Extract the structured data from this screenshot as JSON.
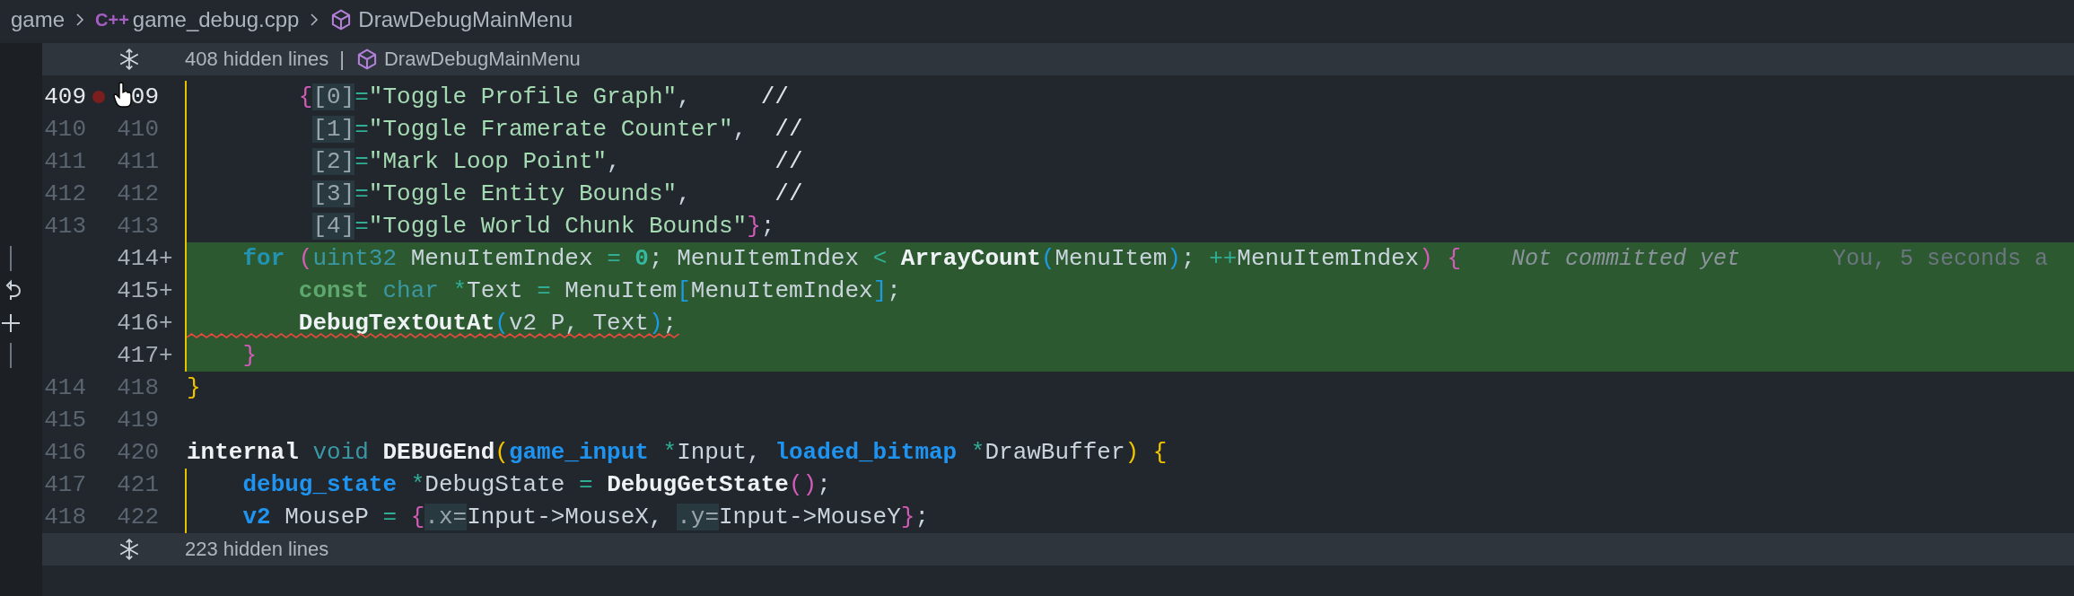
{
  "breadcrumb": [
    {
      "kind": "folder",
      "text": "game"
    },
    {
      "kind": "file",
      "badge": "C++",
      "text": "game_debug.cpp"
    },
    {
      "kind": "symbol",
      "text": "DrawDebugMainMenu"
    }
  ],
  "folds_top": {
    "text": "408 hidden lines",
    "separator": "|",
    "symbol": "DrawDebugMainMenu"
  },
  "lines": [
    {
      "old": "409",
      "new": "09",
      "added": false,
      "breakpoint": true,
      "current": true,
      "error": false,
      "guide": true,
      "tokens": [
        {
          "kind": "pink",
          "text": "        {"
        },
        {
          "kind": "hint",
          "text": "[0]"
        },
        {
          "kind": "op",
          "text": "="
        },
        {
          "kind": "string",
          "text": "\"Toggle Profile Graph\""
        },
        {
          "kind": "plain",
          "text": ",     "
        },
        {
          "kind": "comment",
          "text": "//"
        }
      ]
    },
    {
      "old": "410",
      "new": "410",
      "added": false,
      "breakpoint": false,
      "current": false,
      "error": false,
      "guide": true,
      "tokens": [
        {
          "kind": "hint",
          "text": "         [1]"
        },
        {
          "kind": "op",
          "text": "="
        },
        {
          "kind": "string",
          "text": "\"Toggle Framerate Counter\""
        },
        {
          "kind": "plain",
          "text": ",  "
        },
        {
          "kind": "comment",
          "text": "//"
        }
      ]
    },
    {
      "old": "411",
      "new": "411",
      "added": false,
      "breakpoint": false,
      "current": false,
      "error": false,
      "guide": true,
      "tokens": [
        {
          "kind": "hint",
          "text": "         [2]"
        },
        {
          "kind": "op",
          "text": "="
        },
        {
          "kind": "string",
          "text": "\"Mark Loop Point\""
        },
        {
          "kind": "plain",
          "text": ",           "
        },
        {
          "kind": "comment",
          "text": "//"
        }
      ]
    },
    {
      "old": "412",
      "new": "412",
      "added": false,
      "breakpoint": false,
      "current": false,
      "error": false,
      "guide": true,
      "tokens": [
        {
          "kind": "hint",
          "text": "         [3]"
        },
        {
          "kind": "op",
          "text": "="
        },
        {
          "kind": "string",
          "text": "\"Toggle Entity Bounds\""
        },
        {
          "kind": "plain",
          "text": ",      "
        },
        {
          "kind": "comment",
          "text": "//"
        }
      ]
    },
    {
      "old": "413",
      "new": "413",
      "added": false,
      "breakpoint": false,
      "current": false,
      "error": false,
      "guide": true,
      "tokens": [
        {
          "kind": "hint",
          "text": "         [4]"
        },
        {
          "kind": "op",
          "text": "="
        },
        {
          "kind": "string",
          "text": "\"Toggle World Chunk Bounds\""
        },
        {
          "kind": "pink",
          "text": "}"
        },
        {
          "kind": "plain",
          "text": ";"
        }
      ]
    },
    {
      "new": "414",
      "marker": "+",
      "added": true,
      "breakpoint": false,
      "current": false,
      "error": false,
      "guide": true,
      "tokens": [
        {
          "kind": "keyword",
          "text": "    for "
        },
        {
          "kind": "pink",
          "text": "("
        },
        {
          "kind": "type2",
          "text": "uint32"
        },
        {
          "kind": "plain",
          "text": " MenuItemIndex "
        },
        {
          "kind": "op",
          "text": "= "
        },
        {
          "kind": "number",
          "text": "0"
        },
        {
          "kind": "plain",
          "text": "; MenuItemIndex "
        },
        {
          "kind": "op",
          "text": "< "
        },
        {
          "kind": "func",
          "text": "ArrayCount"
        },
        {
          "kind": "blue",
          "text": "("
        },
        {
          "kind": "plain",
          "text": "MenuItem"
        },
        {
          "kind": "blue",
          "text": ")"
        },
        {
          "kind": "plain",
          "text": "; "
        },
        {
          "kind": "op",
          "text": "++"
        },
        {
          "kind": "plain",
          "text": "MenuItemIndex"
        },
        {
          "kind": "pink",
          "text": ") {"
        }
      ],
      "blame": [
        "Not committed yet",
        "You, 5 seconds a"
      ]
    },
    {
      "new": "415",
      "marker": "+",
      "added": true,
      "breakpoint": false,
      "current": false,
      "error": false,
      "guide": true,
      "tokens": [
        {
          "kind": "keyword2",
          "text": "        const "
        },
        {
          "kind": "type2",
          "text": "char "
        },
        {
          "kind": "op",
          "text": "*"
        },
        {
          "kind": "plain",
          "text": "Text "
        },
        {
          "kind": "op",
          "text": "="
        },
        {
          "kind": "plain",
          "text": " MenuItem"
        },
        {
          "kind": "blue",
          "text": "["
        },
        {
          "kind": "plain",
          "text": "MenuItemIndex"
        },
        {
          "kind": "blue",
          "text": "]"
        },
        {
          "kind": "plain",
          "text": ";"
        }
      ]
    },
    {
      "new": "416",
      "marker": "+",
      "added": true,
      "breakpoint": false,
      "current": false,
      "error": true,
      "guide": true,
      "tokens": [
        {
          "kind": "func",
          "text": "        DebugTextOutAt"
        },
        {
          "kind": "blue",
          "text": "("
        },
        {
          "kind": "plain",
          "text": "v2 P, Text"
        },
        {
          "kind": "blue",
          "text": ")"
        },
        {
          "kind": "plain",
          "text": ";"
        }
      ]
    },
    {
      "new": "417",
      "marker": "+",
      "added": true,
      "breakpoint": false,
      "current": false,
      "error": false,
      "guide": true,
      "tokens": [
        {
          "kind": "pink",
          "text": "    }"
        }
      ]
    },
    {
      "old": "414",
      "new": "418",
      "added": false,
      "breakpoint": false,
      "current": false,
      "error": false,
      "guide": false,
      "tokens": [
        {
          "kind": "yellow",
          "text": "}"
        }
      ]
    },
    {
      "old": "415",
      "new": "419",
      "added": false,
      "breakpoint": false,
      "current": false,
      "error": false,
      "guide": false
    },
    {
      "old": "416",
      "new": "420",
      "added": false,
      "breakpoint": false,
      "current": false,
      "error": false,
      "guide": false,
      "tokens": [
        {
          "kind": "keyword3",
          "text": "internal "
        },
        {
          "kind": "type2",
          "text": "void "
        },
        {
          "kind": "func",
          "text": "DEBUGEnd"
        },
        {
          "kind": "yellow",
          "text": "("
        },
        {
          "kind": "type",
          "text": "game_input "
        },
        {
          "kind": "op",
          "text": "*"
        },
        {
          "kind": "plain",
          "text": "Input, "
        },
        {
          "kind": "type",
          "text": "loaded_bitmap "
        },
        {
          "kind": "op",
          "text": "*"
        },
        {
          "kind": "plain",
          "text": "DrawBuffer"
        },
        {
          "kind": "yellow",
          "text": ") {"
        }
      ]
    },
    {
      "old": "417",
      "new": "421",
      "added": false,
      "breakpoint": false,
      "current": false,
      "error": false,
      "guide": true,
      "tokens": [
        {
          "kind": "type",
          "text": "    debug_state "
        },
        {
          "kind": "op",
          "text": "*"
        },
        {
          "kind": "plain",
          "text": "DebugState "
        },
        {
          "kind": "op",
          "text": "= "
        },
        {
          "kind": "func",
          "text": "DebugGetState"
        },
        {
          "kind": "pink",
          "text": "()"
        },
        {
          "kind": "plain",
          "text": ";"
        }
      ]
    },
    {
      "old": "418",
      "new": "422",
      "added": false,
      "breakpoint": false,
      "current": false,
      "error": false,
      "guide": true,
      "tokens": [
        {
          "kind": "type",
          "text": "    v2"
        },
        {
          "kind": "plain",
          "text": " MouseP "
        },
        {
          "kind": "op",
          "text": "= "
        },
        {
          "kind": "pink",
          "text": "{"
        },
        {
          "kind": "hint",
          "text": ".x="
        },
        {
          "kind": "plain",
          "text": "Input->MouseX, "
        },
        {
          "kind": "hint",
          "text": ".y="
        },
        {
          "kind": "plain",
          "text": "Input->MouseY"
        },
        {
          "kind": "pink",
          "text": "}"
        },
        {
          "kind": "plain",
          "text": ";"
        }
      ]
    }
  ],
  "folds_bottom": {
    "text": "223 hidden lines"
  }
}
